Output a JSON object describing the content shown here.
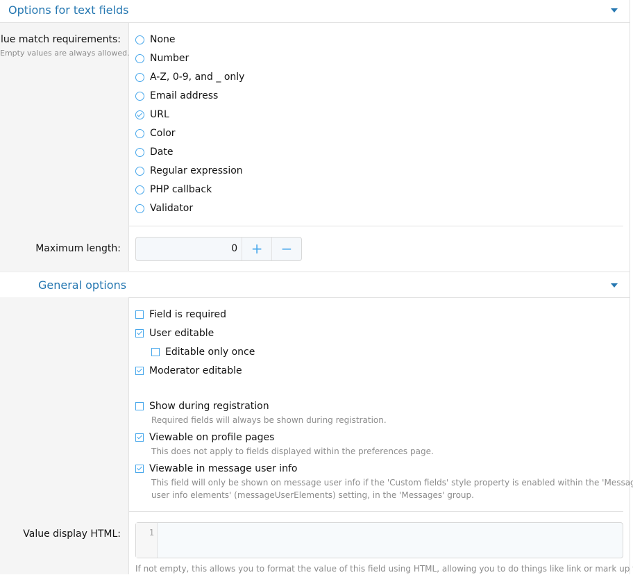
{
  "text_options": {
    "title": "Options for text fields",
    "match": {
      "label": "Value match requirements:",
      "hint": "Empty values are always allowed.",
      "options": [
        "None",
        "Number",
        "A-Z, 0-9, and _ only",
        "Email address",
        "URL",
        "Color",
        "Date",
        "Regular expression",
        "PHP callback",
        "Validator"
      ],
      "selected": "URL"
    },
    "max_length": {
      "label": "Maximum length:",
      "value": "0",
      "plus": "+",
      "minus": "−"
    }
  },
  "general_options": {
    "title": "General options",
    "field_required": "Field is required",
    "user_editable": "User editable",
    "editable_once": "Editable only once",
    "moderator_editable": "Moderator editable",
    "show_registration": "Show during registration",
    "show_registration_desc": "Required fields will always be shown during registration.",
    "viewable_profile": "Viewable on profile pages",
    "viewable_profile_desc": "This does not apply to fields displayed within the preferences page.",
    "viewable_message": "Viewable in message user info",
    "viewable_message_desc_1": "This field will only be shown on message user info if the 'Custom fields' style property is enabled within the 'Message",
    "viewable_message_desc_2": "user info elements' (messageUserElements) setting, in the 'Messages' group.",
    "value_display_html": {
      "label": "Value display HTML:",
      "line_number": "1",
      "explain": "If not empty, this allows you to format the value of this field using HTML, allowing you to do things like link or mark up the"
    }
  },
  "colors": {
    "accent": "#47a7eb",
    "title": "#2577b1",
    "label_bg": "#f5f5f5"
  }
}
